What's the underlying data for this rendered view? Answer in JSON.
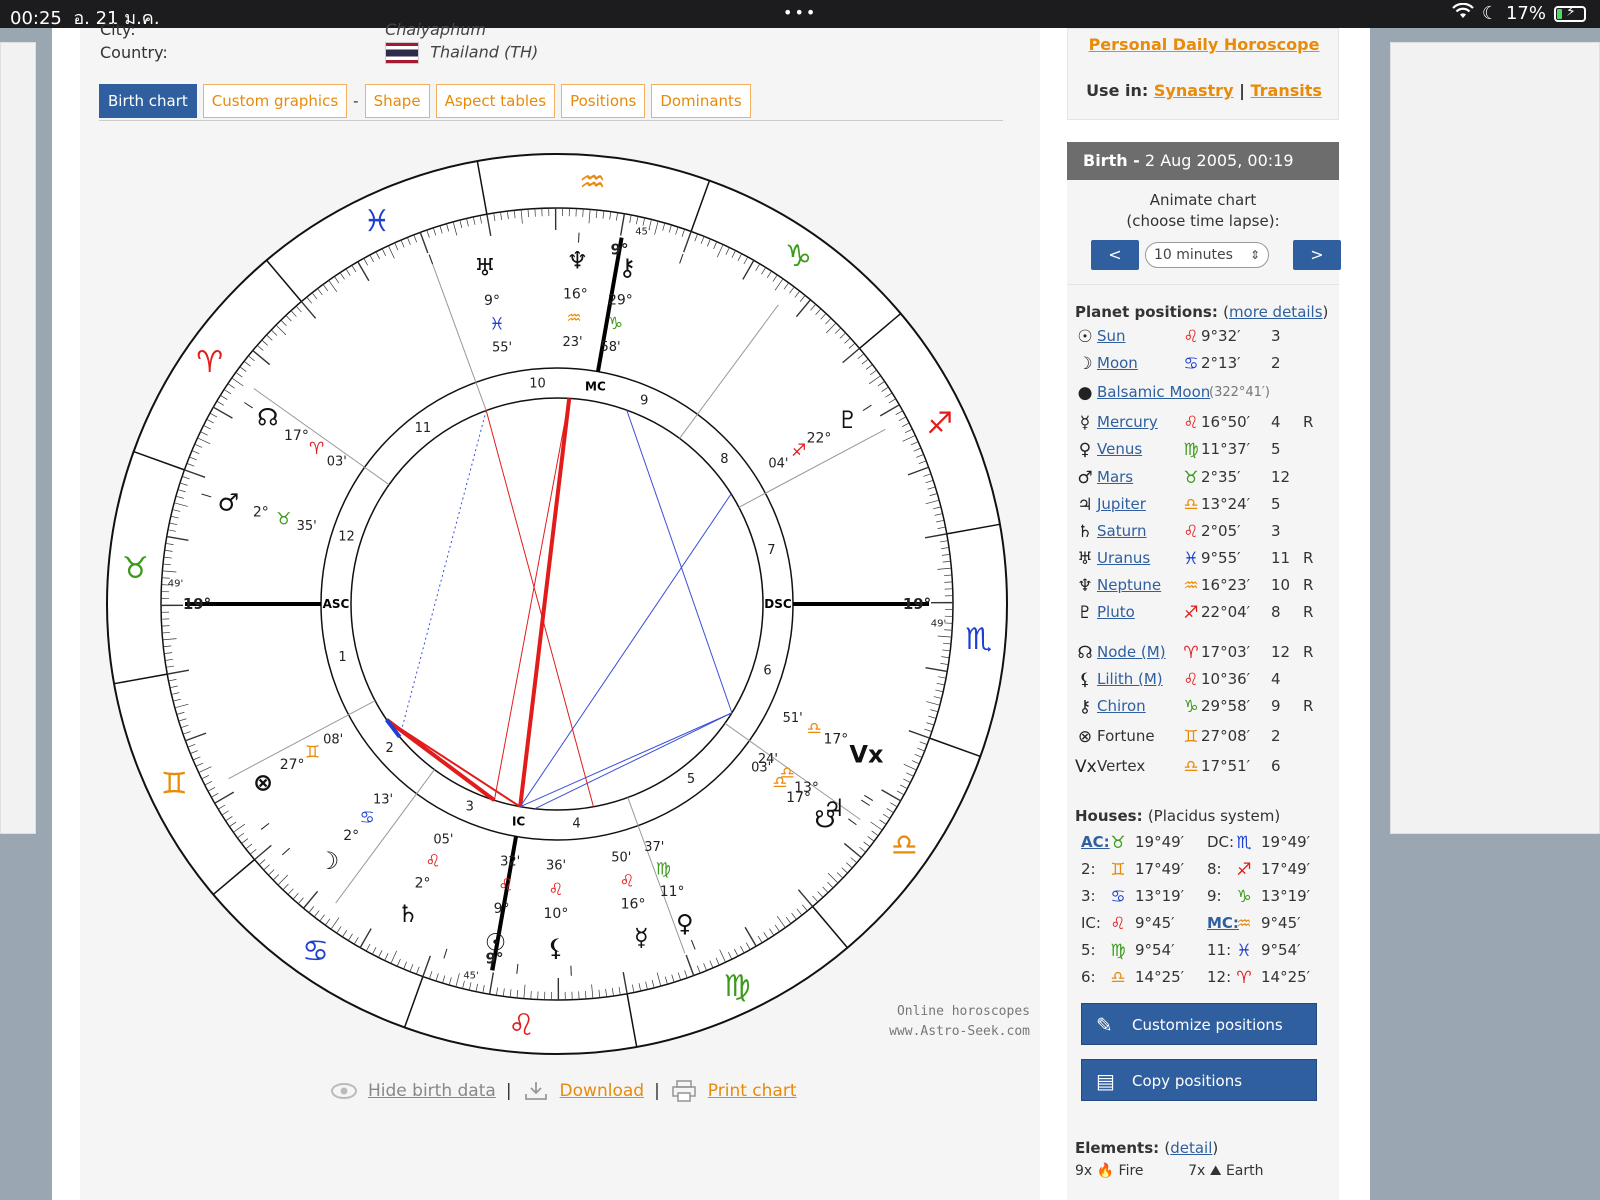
{
  "status": {
    "time": "00:25",
    "date": "อ. 21 ม.ค.",
    "battery": "17%"
  },
  "birth_info": {
    "city_label": "City:",
    "city_value": "Chaiyaphum",
    "country_label": "Country:",
    "country_value": "Thailand (TH)"
  },
  "tabs": [
    {
      "label": "Birth chart",
      "active": true
    },
    {
      "label": "Custom graphics"
    },
    {
      "label": "Shape"
    },
    {
      "label": "Aspect tables"
    },
    {
      "label": "Positions"
    },
    {
      "label": "Dominants"
    }
  ],
  "tab_separator": "-",
  "chart": {
    "zodiac_signs": [
      {
        "glyph": "♈",
        "color": "#e21b1b"
      },
      {
        "glyph": "♉",
        "color": "#3a9a1a"
      },
      {
        "glyph": "♊",
        "color": "#e88a0a"
      },
      {
        "glyph": "♋",
        "color": "#1f3fd1"
      },
      {
        "glyph": "♌",
        "color": "#e21b1b"
      },
      {
        "glyph": "♍",
        "color": "#3a9a1a"
      },
      {
        "glyph": "♎",
        "color": "#e88a0a"
      },
      {
        "glyph": "♏",
        "color": "#1f3fd1"
      },
      {
        "glyph": "♐",
        "color": "#e21b1b"
      },
      {
        "glyph": "♑",
        "color": "#3a9a1a"
      },
      {
        "glyph": "♒",
        "color": "#e88a0a"
      },
      {
        "glyph": "♓",
        "color": "#1f3fd1"
      }
    ],
    "house_numbers": [
      "1",
      "2",
      "3",
      "4",
      "5",
      "6",
      "7",
      "8",
      "9",
      "10",
      "11",
      "12"
    ],
    "axis_labels": {
      "asc": "ASC",
      "dsc": "DSC",
      "mc": "MC",
      "ic": "IC"
    },
    "asc_degree": "19°",
    "asc_minutes": "49'",
    "dsc_degree": "19°",
    "dsc_minutes": "49'",
    "mc_degree": "9°",
    "mc_minutes": "45'",
    "ic_degree": "9°",
    "ic_minutes": "45'",
    "planets_on_wheel": [
      {
        "glyph": "♆",
        "retro": true,
        "deg": "16°",
        "sign": "♒",
        "sign_color": "#e88a0a",
        "min": "23'",
        "lon": 316.4
      },
      {
        "glyph": "♅",
        "retro": true,
        "deg": "9°",
        "sign": "♓",
        "sign_color": "#1f3fd1",
        "min": "55'",
        "lon": 339.9
      },
      {
        "glyph": "⚷",
        "retro": true,
        "deg": "29°",
        "sign": "♑",
        "sign_color": "#3a9a1a",
        "min": "58'",
        "lon": 300.0
      },
      {
        "glyph": "♇",
        "retro": true,
        "deg": "22°",
        "sign": "♐",
        "sign_color": "#e21b1b",
        "min": "04'",
        "lon": 262.1
      },
      {
        "glyph": "☊",
        "retro": true,
        "deg": "17°",
        "sign": "♈",
        "sign_color": "#e21b1b",
        "min": "03'",
        "lon": 17.0
      },
      {
        "glyph": "♂",
        "retro": false,
        "deg": "2°",
        "sign": "♉",
        "sign_color": "#3a9a1a",
        "min": "35'",
        "lon": 32.6
      },
      {
        "glyph": "⊗",
        "retro": false,
        "deg": "27°",
        "sign": "♊",
        "sign_color": "#e88a0a",
        "min": "08'",
        "lon": 87.1
      },
      {
        "glyph": "☽",
        "retro": false,
        "deg": "2°",
        "sign": "♋",
        "sign_color": "#1f3fd1",
        "min": "13'",
        "lon": 92.2
      },
      {
        "glyph": "♄",
        "retro": false,
        "deg": "2°",
        "sign": "♌",
        "sign_color": "#e21b1b",
        "min": "05'",
        "lon": 122.1
      },
      {
        "glyph": "☉",
        "retro": false,
        "deg": "9°",
        "sign": "♌",
        "sign_color": "#e21b1b",
        "min": "32'",
        "lon": 129.5
      },
      {
        "glyph": "⚸",
        "retro": false,
        "deg": "10°",
        "sign": "♌",
        "sign_color": "#e21b1b",
        "min": "36'",
        "lon": 133.6
      },
      {
        "glyph": "☿",
        "retro": true,
        "deg": "16°",
        "sign": "♌",
        "sign_color": "#e21b1b",
        "min": "50'",
        "lon": 142.0
      },
      {
        "glyph": "♀",
        "retro": false,
        "deg": "11°",
        "sign": "♍",
        "sign_color": "#3a9a1a",
        "min": "37'",
        "lon": 161.6
      },
      {
        "glyph": "♃",
        "retro": false,
        "deg": "13°",
        "sign": "♎",
        "sign_color": "#e88a0a",
        "min": "24'",
        "lon": 193.4
      },
      {
        "glyph": "Vx",
        "retro": false,
        "deg": "17°",
        "sign": "♎",
        "sign_color": "#e88a0a",
        "min": "51'",
        "lon": 197.9
      },
      {
        "glyph": "☋",
        "retro": true,
        "deg": "17°",
        "sign": "♎",
        "sign_color": "#e88a0a",
        "min": "03'",
        "lon": 197.0
      }
    ],
    "aspects": [
      {
        "from": 84.0,
        "to": 122.1,
        "color": "#e21b1b",
        "width": 4
      },
      {
        "from": 84.0,
        "to": 129.5,
        "color": "#e21b1b",
        "width": 2
      },
      {
        "from": 129.5,
        "to": 316.4,
        "color": "#e21b1b",
        "width": 4
      },
      {
        "from": 122.1,
        "to": 316.4,
        "color": "#e21b1b",
        "width": 1
      },
      {
        "from": 84.0,
        "to": 90.0,
        "color": "#1f3fd1",
        "width": 4
      },
      {
        "from": 129.5,
        "to": 197.9,
        "color": "#3b4fd8",
        "width": 1
      },
      {
        "from": 133.6,
        "to": 197.9,
        "color": "#3b4fd8",
        "width": 1
      },
      {
        "from": 197.9,
        "to": 300.0,
        "color": "#3b4fd8",
        "width": 1
      },
      {
        "from": 129.5,
        "to": 262.1,
        "color": "#3b4fd8",
        "width": 1
      },
      {
        "from": 339.9,
        "to": 90.0,
        "color": "#3b4fd8",
        "width": 1,
        "dashed": true
      },
      {
        "from": 339.9,
        "to": 150.0,
        "color": "#e21b1b",
        "width": 1
      }
    ],
    "watermark_line1": "Online horoscopes",
    "watermark_line2": "www.Astro-Seek.com"
  },
  "chart_links": {
    "hide": "Hide birth data",
    "download": "Download",
    "print": "Print chart",
    "sep": "|"
  },
  "sidebar": {
    "personal_daily": "Personal Daily Horoscope",
    "use_in_label": "Use in:",
    "synastry": "Synastry",
    "transits": "Transits",
    "use_sep": "|",
    "birth_label": "Birth -",
    "birth_value": "2 Aug 2005, 00:19",
    "animate_line1": "Animate chart",
    "animate_line2": "(choose time lapse):",
    "prev": "<",
    "next": ">",
    "time_lapse": "10 minutes",
    "planet_title": "Planet positions:",
    "more_details": "more details",
    "planets": [
      {
        "glyph": "☉",
        "name": "Sun",
        "sign": "♌",
        "sign_color": "#e21b1b",
        "deg": "9°32′",
        "house": "3",
        "retro": ""
      },
      {
        "glyph": "☽",
        "name": "Moon",
        "sign": "♋",
        "sign_color": "#1f3fd1",
        "deg": "2°13′",
        "house": "2",
        "retro": ""
      },
      {
        "glyph": "●",
        "name": "Balsamic Moon",
        "extra": "(322°41′)"
      },
      {
        "glyph": "☿",
        "name": "Mercury",
        "sign": "♌",
        "sign_color": "#e21b1b",
        "deg": "16°50′",
        "house": "4",
        "retro": "R"
      },
      {
        "glyph": "♀",
        "name": "Venus",
        "sign": "♍",
        "sign_color": "#3a9a1a",
        "deg": "11°37′",
        "house": "5",
        "retro": ""
      },
      {
        "glyph": "♂",
        "name": "Mars",
        "sign": "♉",
        "sign_color": "#3a9a1a",
        "deg": "2°35′",
        "house": "12",
        "retro": ""
      },
      {
        "glyph": "♃",
        "name": "Jupiter",
        "sign": "♎",
        "sign_color": "#e88a0a",
        "deg": "13°24′",
        "house": "5",
        "retro": ""
      },
      {
        "glyph": "♄",
        "name": "Saturn",
        "sign": "♌",
        "sign_color": "#e21b1b",
        "deg": "2°05′",
        "house": "3",
        "retro": ""
      },
      {
        "glyph": "♅",
        "name": "Uranus",
        "sign": "♓",
        "sign_color": "#1f3fd1",
        "deg": "9°55′",
        "house": "11",
        "retro": "R"
      },
      {
        "glyph": "♆",
        "name": "Neptune",
        "sign": "♒",
        "sign_color": "#e88a0a",
        "deg": "16°23′",
        "house": "10",
        "retro": "R"
      },
      {
        "glyph": "♇",
        "name": "Pluto",
        "sign": "♐",
        "sign_color": "#e21b1b",
        "deg": "22°04′",
        "house": "8",
        "retro": "R"
      },
      {
        "glyph": "☊",
        "name": "Node (M)",
        "sign": "♈",
        "sign_color": "#e21b1b",
        "deg": "17°03′",
        "house": "12",
        "retro": "R"
      },
      {
        "glyph": "⚸",
        "name": "Lilith (M)",
        "sign": "♌",
        "sign_color": "#e21b1b",
        "deg": "10°36′",
        "house": "4",
        "retro": ""
      },
      {
        "glyph": "⚷",
        "name": "Chiron",
        "sign": "♑",
        "sign_color": "#3a9a1a",
        "deg": "29°58′",
        "house": "9",
        "retro": "R"
      },
      {
        "glyph": "⊗",
        "name": "Fortune",
        "plain": true,
        "sign": "♊",
        "sign_color": "#e88a0a",
        "deg": "27°08′",
        "house": "2",
        "retro": ""
      },
      {
        "glyph": "Vx",
        "name": "Vertex",
        "plain": true,
        "sign": "♎",
        "sign_color": "#e88a0a",
        "deg": "17°51′",
        "house": "6",
        "retro": ""
      }
    ],
    "houses_title": "Houses:",
    "houses_system": "(Placidus system)",
    "houses": [
      {
        "l": "AC:",
        "link": true,
        "sign": "♉",
        "sign_color": "#3a9a1a",
        "deg": "19°49′",
        "l2": "DC:",
        "link2": false,
        "sign2": "♏",
        "sign2_color": "#1f3fd1",
        "deg2": "19°49′"
      },
      {
        "l": "2:",
        "sign": "♊",
        "sign_color": "#e88a0a",
        "deg": "17°49′",
        "l2": "8:",
        "sign2": "♐",
        "sign2_color": "#e21b1b",
        "deg2": "17°49′"
      },
      {
        "l": "3:",
        "sign": "♋",
        "sign_color": "#1f3fd1",
        "deg": "13°19′",
        "l2": "9:",
        "sign2": "♑",
        "sign2_color": "#3a9a1a",
        "deg2": "13°19′"
      },
      {
        "l": "IC:",
        "sign": "♌",
        "sign_color": "#e21b1b",
        "deg": "9°45′",
        "l2": "MC:",
        "link2": true,
        "sign2": "♒",
        "sign2_color": "#e88a0a",
        "deg2": "9°45′"
      },
      {
        "l": "5:",
        "sign": "♍",
        "sign_color": "#3a9a1a",
        "deg": "9°54′",
        "l2": "11:",
        "sign2": "♓",
        "sign2_color": "#1f3fd1",
        "deg2": "9°54′"
      },
      {
        "l": "6:",
        "sign": "♎",
        "sign_color": "#e88a0a",
        "deg": "14°25′",
        "l2": "12:",
        "sign2": "♈",
        "sign2_color": "#e21b1b",
        "deg2": "14°25′"
      }
    ],
    "customize": "Customize positions",
    "copy": "Copy positions",
    "elements_title": "Elements:",
    "elements_detail": "detail",
    "elements_fire": "9x",
    "elements_fire_label": "Fire",
    "elements_earth": "7x",
    "elements_earth_label": "Earth"
  }
}
